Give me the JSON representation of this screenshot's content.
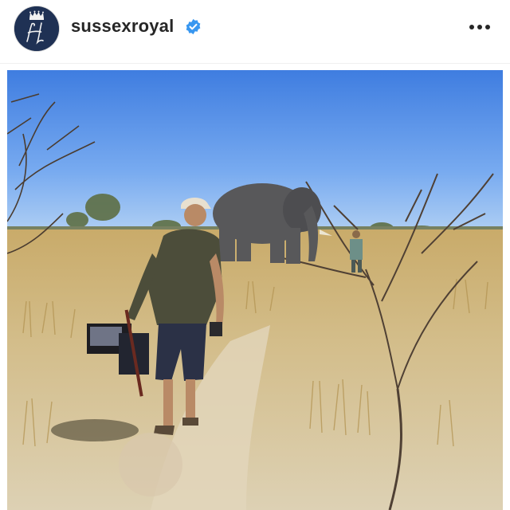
{
  "post": {
    "username": "sussexroyal",
    "verified": true,
    "menu_icon": "more-horizontal-icon",
    "avatar_icon": "crowned-monogram-icon",
    "verified_icon": "verified-badge-icon"
  },
  "photo": {
    "subjects": [
      "elephant-figure",
      "walking-man-figure",
      "distant-person-figure"
    ]
  },
  "colors": {
    "verified_blue": "#3897f0",
    "avatar_navy": "#1f3154",
    "username_text": "#262626",
    "sky_top": "#3f7de0",
    "grass": "#cdb57a"
  }
}
